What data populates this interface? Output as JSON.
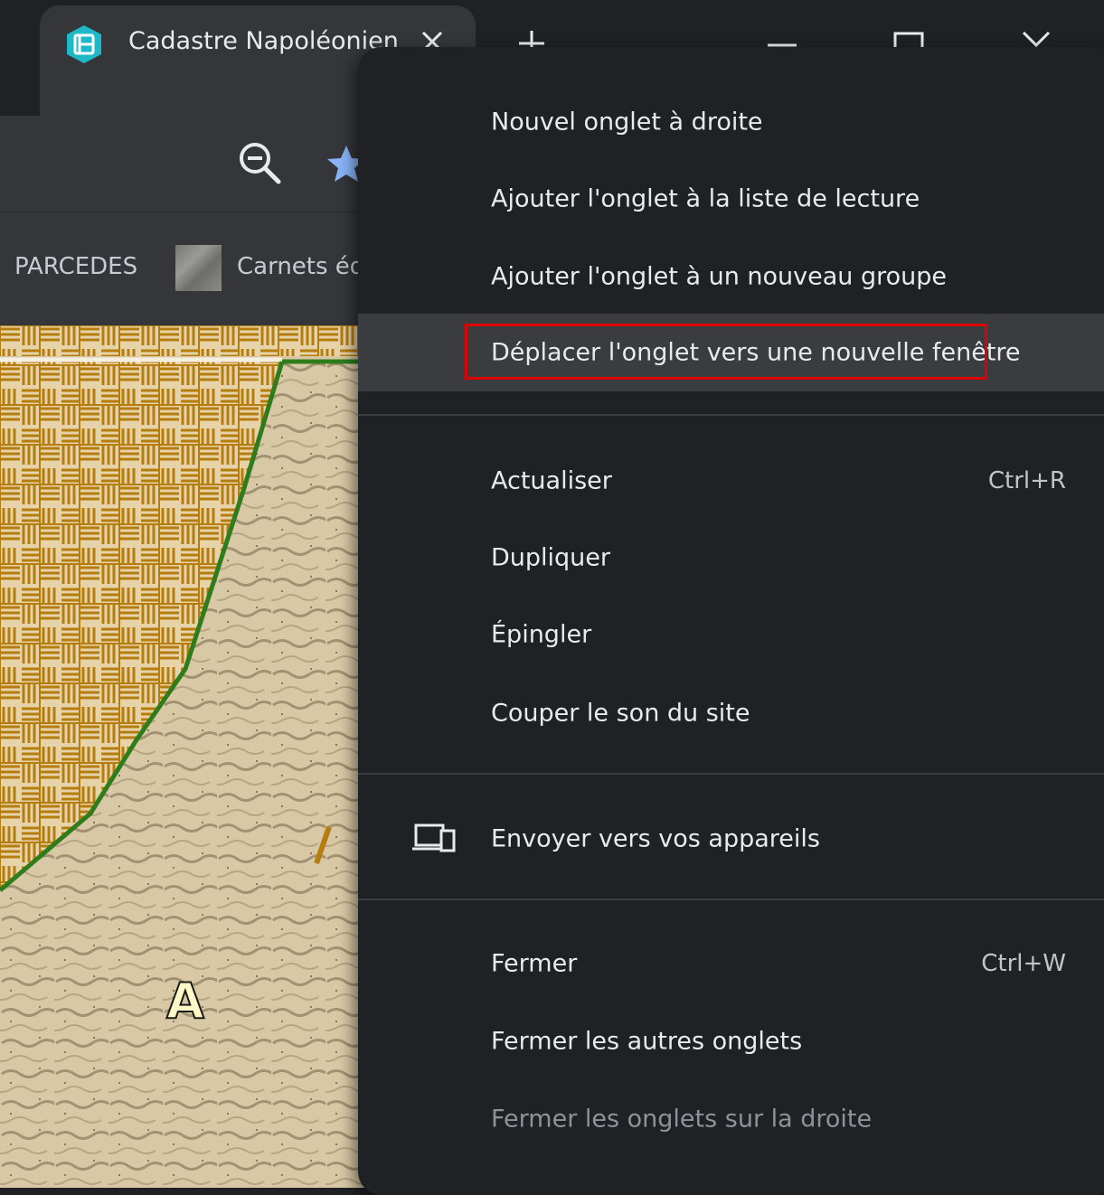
{
  "tab": {
    "title": "Cadastre Napoléonien",
    "favicon": "cadastre-app-icon",
    "accent": "#1fb8c9"
  },
  "bookmarks": {
    "items": [
      {
        "label": "PARCEDES"
      },
      {
        "label": "Carnets édi"
      }
    ]
  },
  "map": {
    "label": "A"
  },
  "context_menu": {
    "items": [
      {
        "label": "Nouvel onglet à droite",
        "shortcut": ""
      },
      {
        "label": "Ajouter l'onglet à la liste de lecture",
        "shortcut": ""
      },
      {
        "label": "Ajouter l'onglet à un nouveau groupe",
        "shortcut": ""
      },
      {
        "label": "Déplacer l'onglet vers une nouvelle fenêtre",
        "shortcut": "",
        "highlighted": true
      },
      {
        "label": "Actualiser",
        "shortcut": "Ctrl+R"
      },
      {
        "label": "Dupliquer",
        "shortcut": ""
      },
      {
        "label": "Épingler",
        "shortcut": ""
      },
      {
        "label": "Couper le son du site",
        "shortcut": ""
      },
      {
        "label": "Envoyer vers vos appareils",
        "shortcut": "",
        "icon": "devices-icon"
      },
      {
        "label": "Fermer",
        "shortcut": "Ctrl+W"
      },
      {
        "label": "Fermer les autres onglets",
        "shortcut": ""
      },
      {
        "label": "Fermer les onglets sur la droite",
        "shortcut": "",
        "disabled": true
      }
    ],
    "highlight_color": "#e00000"
  }
}
